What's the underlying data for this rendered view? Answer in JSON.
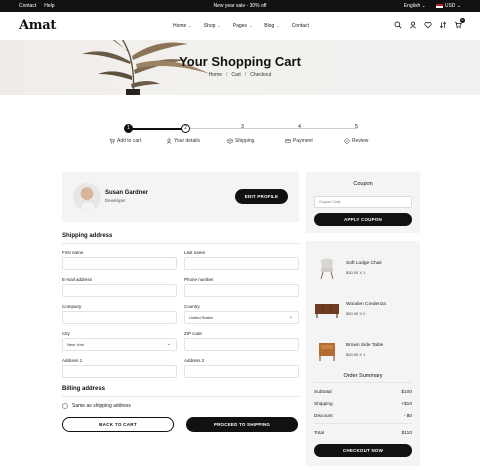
{
  "topbar": {
    "links": [
      "Contact",
      "Help"
    ],
    "announcement": "New year sale - 30% off",
    "language": "English",
    "currency": "USD"
  },
  "header": {
    "logo": "Amat",
    "nav": [
      {
        "label": "Home",
        "has_dropdown": true
      },
      {
        "label": "Shop",
        "has_dropdown": true
      },
      {
        "label": "Pages",
        "has_dropdown": true
      },
      {
        "label": "Blog",
        "has_dropdown": true
      },
      {
        "label": "Contact",
        "has_dropdown": false
      }
    ],
    "icons": [
      "search-icon",
      "user-icon",
      "heart-icon",
      "compare-icon",
      "cart-icon"
    ],
    "cart_count": "0"
  },
  "hero": {
    "title": "Your Shopping Cart",
    "breadcrumb": [
      "Home",
      "Cart",
      "Checkout"
    ]
  },
  "steps": [
    {
      "number": "1",
      "label": "Add to cart",
      "icon": "cart-icon",
      "state": "done"
    },
    {
      "number": "2",
      "label": "Your details",
      "icon": "user-icon",
      "state": "current"
    },
    {
      "number": "3",
      "label": "Shipping",
      "icon": "box-icon",
      "state": "pending"
    },
    {
      "number": "4",
      "label": "Payment",
      "icon": "card-icon",
      "state": "pending"
    },
    {
      "number": "5",
      "label": "Review",
      "icon": "check-circle-icon",
      "state": "pending"
    }
  ],
  "profile": {
    "name": "Susan Gardner",
    "role": "Developer",
    "edit_label": "EDIT PROFILE"
  },
  "shipping": {
    "title": "Shipping address",
    "fields": {
      "first_name": {
        "label": "First name",
        "value": ""
      },
      "last_name": {
        "label": "Last name",
        "value": ""
      },
      "email": {
        "label": "E-mail address",
        "value": ""
      },
      "phone": {
        "label": "Phone number",
        "value": ""
      },
      "company": {
        "label": "Company",
        "value": ""
      },
      "country": {
        "label": "Country",
        "value": "United States"
      },
      "city": {
        "label": "City",
        "value": "New York"
      },
      "zip": {
        "label": "ZIP code",
        "value": ""
      },
      "address1": {
        "label": "Address 1",
        "value": ""
      },
      "address2": {
        "label": "Address 2",
        "value": ""
      }
    }
  },
  "billing": {
    "title": "Billing address",
    "same_as_shipping": "Same as shipping address"
  },
  "actions": {
    "back": "BACK TO CART",
    "proceed": "PROCEED TO SHIPPING"
  },
  "coupon": {
    "title": "Coupon",
    "placeholder": "Coupon Code",
    "apply": "APPLY COUPON"
  },
  "cart_items": [
    {
      "name": "Soft Lodge Chair",
      "price": "$30.00 X 1"
    },
    {
      "name": "Wooden Credenza",
      "price": "$50.00 X 2"
    },
    {
      "name": "Brown Side Table",
      "price": "$30.00 X 1"
    }
  ],
  "summary": {
    "title": "Order Summary",
    "rows": [
      {
        "label": "Subtotal",
        "value": "$100"
      },
      {
        "label": "Shipping",
        "value": "+$10"
      },
      {
        "label": "Discount",
        "value": "- $0"
      },
      {
        "label": "Total",
        "value": "$110"
      }
    ],
    "checkout": "CHECKOUT NOW"
  }
}
